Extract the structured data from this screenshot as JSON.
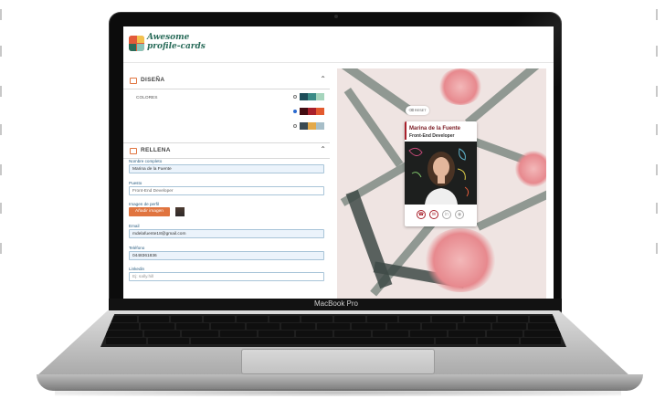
{
  "device": {
    "brand": "MacBook Pro"
  },
  "app": {
    "logo_line1": "Awesome",
    "logo_line2": "profile-cards"
  },
  "design_section": {
    "title": "DISEÑA",
    "colores_label": "COLORES",
    "palettes": [
      {
        "selected": false,
        "colors": [
          "#1e4e5a",
          "#3b8b87",
          "#a6d5bd"
        ]
      },
      {
        "selected": true,
        "colors": [
          "#420d12",
          "#a8202b",
          "#e35a2f"
        ]
      },
      {
        "selected": false,
        "colors": [
          "#3a4a52",
          "#e3a94a",
          "#a7bec8"
        ]
      }
    ]
  },
  "fill_section": {
    "title": "RELLENA",
    "fields": {
      "name_label": "Nombre completo",
      "name_value": "Marina de la Fuente",
      "job_label": "Puesto",
      "job_value": "Front-End Developer",
      "image_label": "Imagen de perfil",
      "image_button": "Añadir imagen",
      "email_label": "Email",
      "email_value": "mdelafuente18@gmail.com",
      "phone_label": "Teléfono",
      "phone_value": "0448361836",
      "linkedin_label": "Linkedin",
      "linkedin_placeholder": "Ej: sally.hill"
    }
  },
  "preview": {
    "reset_label": "RESET",
    "card_name": "Marina de la Fuente",
    "card_job": "Front-End Developer",
    "social_icons": [
      {
        "icon": "phone-icon",
        "active": true
      },
      {
        "icon": "email-icon",
        "active": true
      },
      {
        "icon": "linkedin-icon",
        "active": false
      },
      {
        "icon": "github-icon",
        "active": false
      }
    ]
  },
  "colors": {
    "accent": "#e0743f",
    "brand_green": "#2a6c5a",
    "card_red": "#a8202b"
  }
}
